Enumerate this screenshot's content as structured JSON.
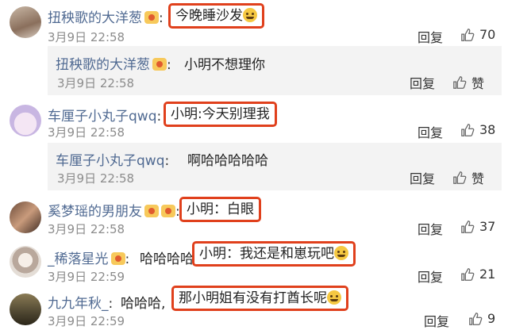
{
  "comments": [
    {
      "name": "扭秧歌的大洋葱",
      "highlight": "今晚睡沙发",
      "time": "3月9日 22:58",
      "reply_label": "回复",
      "likes": "70",
      "sub_reply": {
        "name": "扭秧歌的大洋葱",
        "text": "小明不想理你",
        "time": "3月9日 22:58",
        "reply_label": "回复",
        "like_label": "赞"
      }
    },
    {
      "name": "车厘子小丸子qwq",
      "highlight": "小明:今天别理我",
      "time": "3月9日 22:58",
      "reply_label": "回复",
      "likes": "38",
      "sub_reply": {
        "name": "车厘子小丸子qwq",
        "text": "啊哈哈哈哈哈",
        "time": "3月9日 22:58",
        "reply_label": "回复",
        "like_label": "赞"
      }
    },
    {
      "name": "奚梦瑶的男朋友",
      "highlight": "小明：白眼",
      "time": "3月9日 22:58",
      "reply_label": "回复",
      "likes": "37"
    },
    {
      "name": "_稀落星光",
      "prefix": "哈哈哈哈",
      "highlight": "小明：我还是和崽玩吧",
      "time": "3月9日 22:59",
      "reply_label": "回复",
      "likes": "21"
    },
    {
      "name": "九九年秋_",
      "prefix": "哈哈哈,",
      "highlight": "那小明姐有没有打酋长呢",
      "time": "3月9日 22:59",
      "reply_label": "回复",
      "likes": "9"
    }
  ],
  "colors": {
    "name": "#506a92",
    "highlight_border": "#e0401c",
    "time": "#8c8c8c",
    "sub_bg": "#f3f3f3"
  }
}
